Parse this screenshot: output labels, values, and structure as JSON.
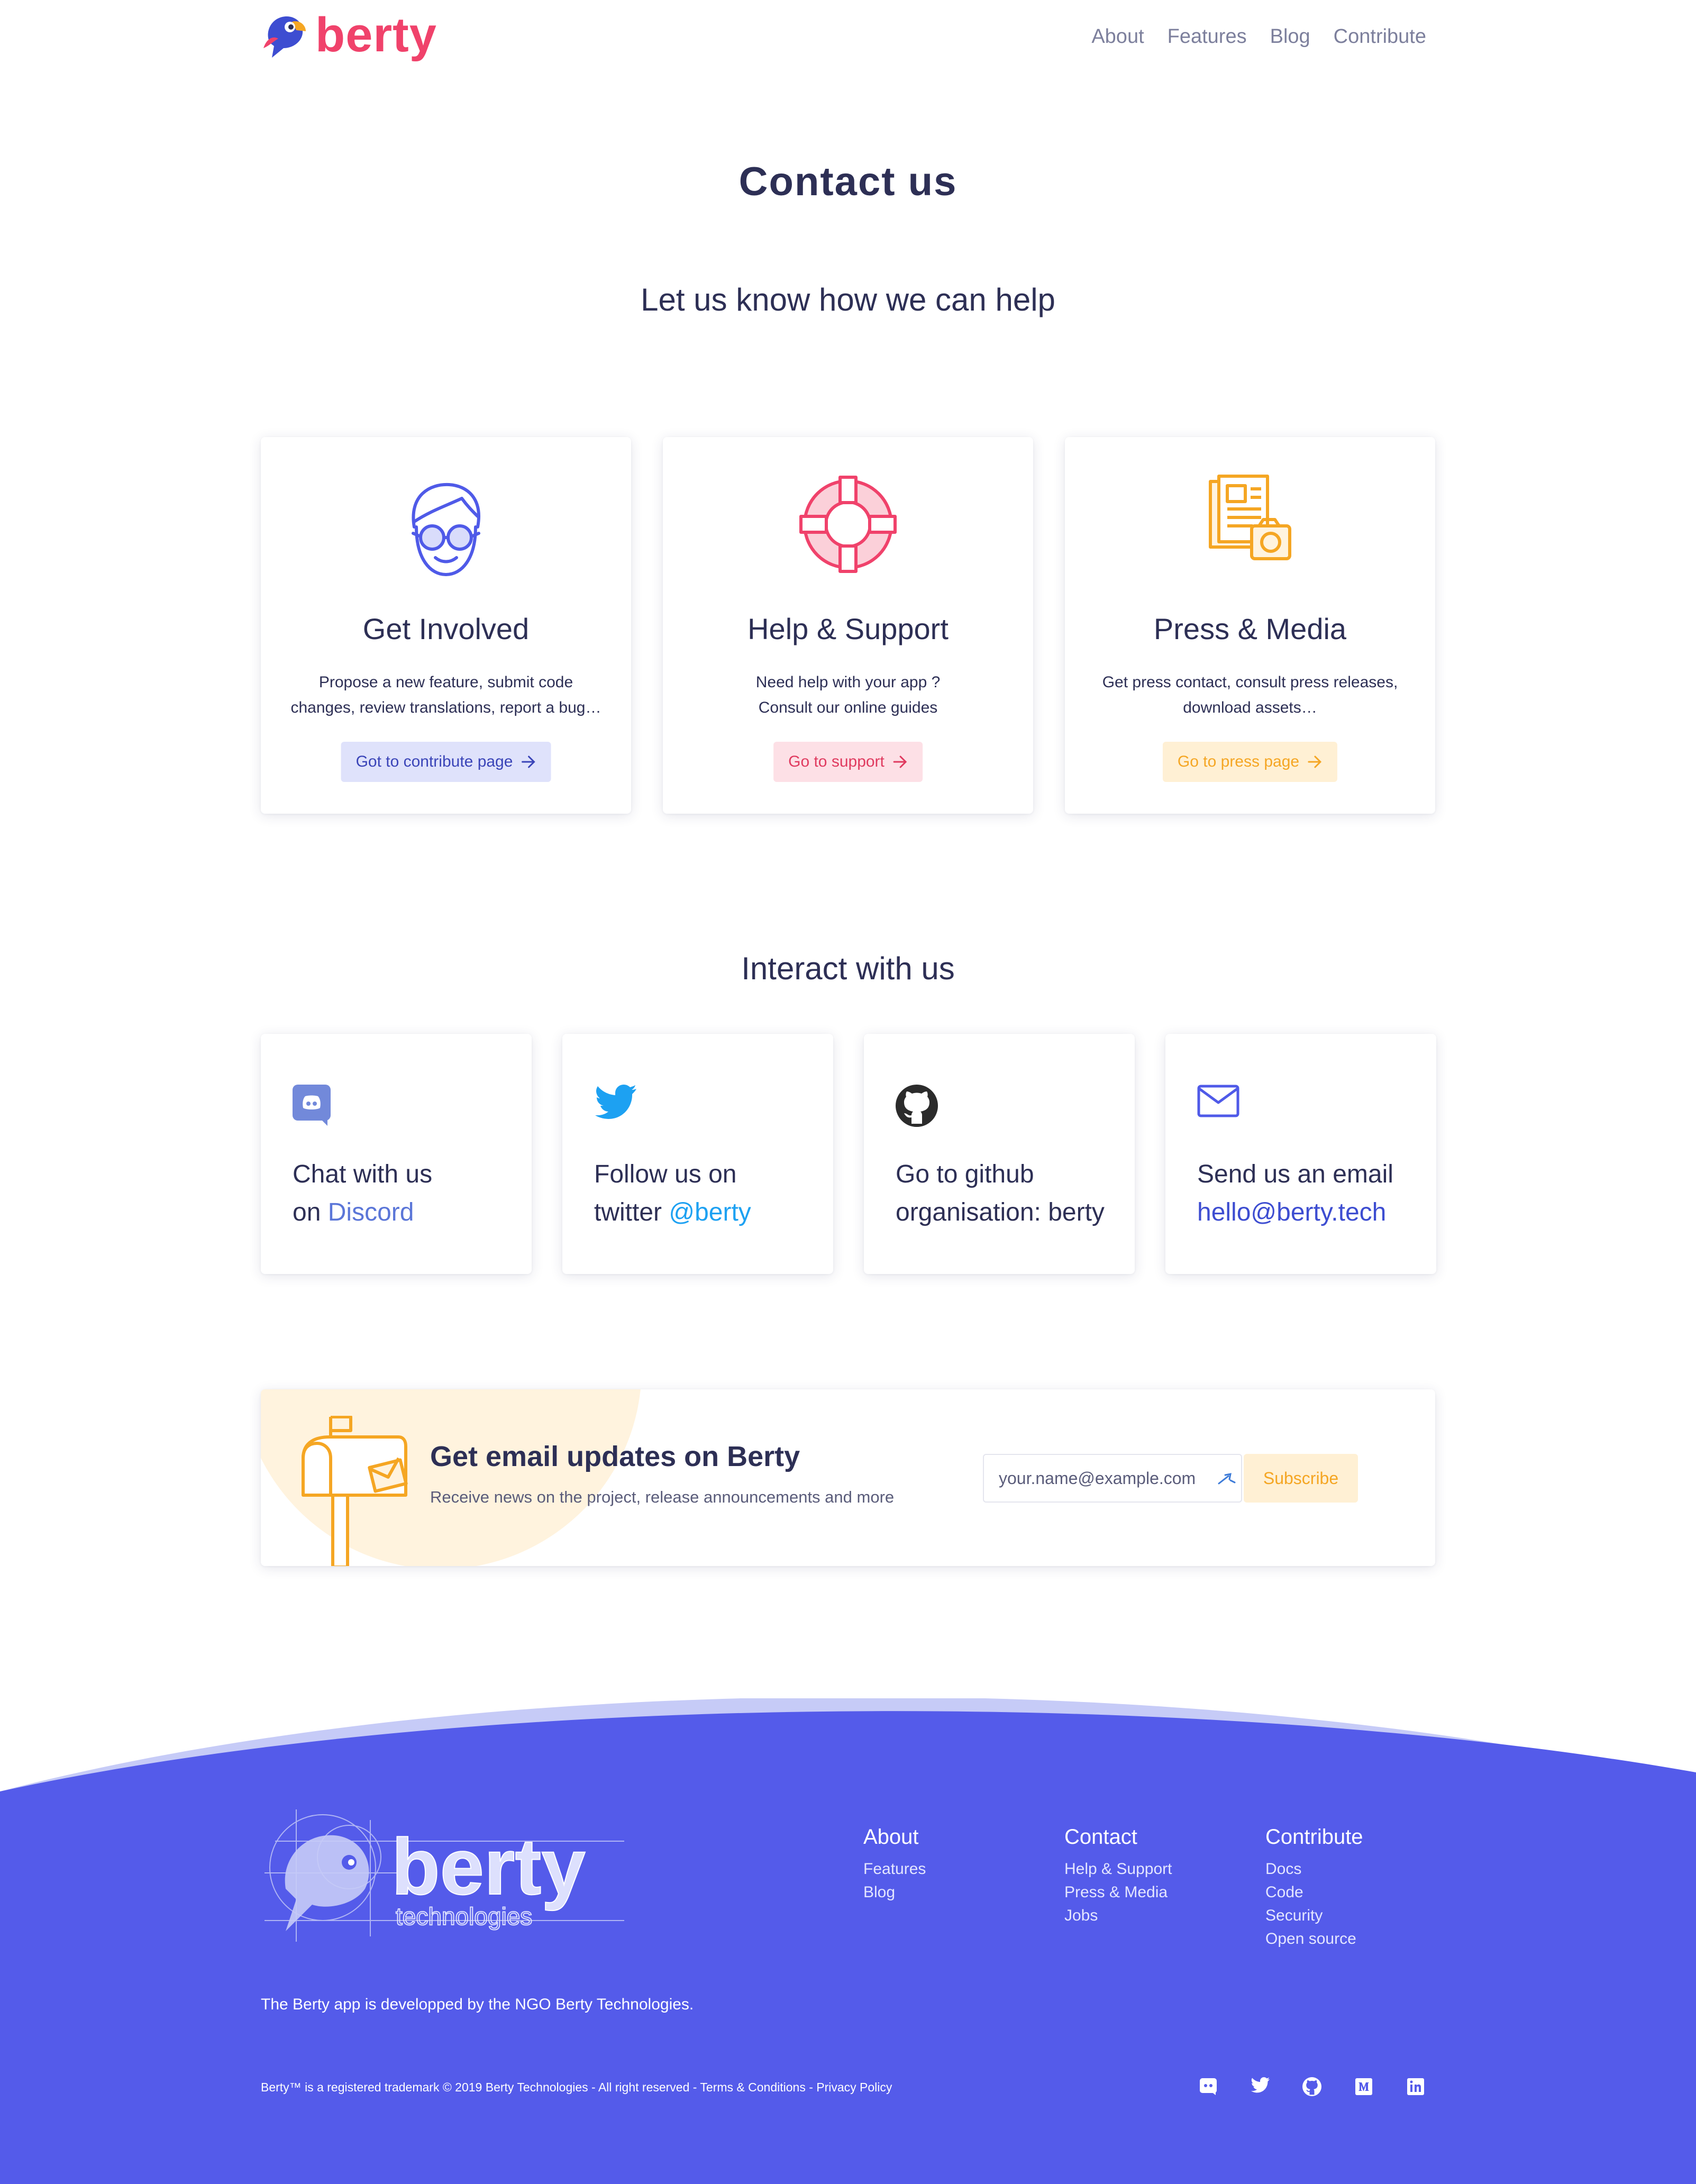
{
  "header": {
    "logo_text": "berty",
    "nav": [
      "About",
      "Features",
      "Blog",
      "Contribute"
    ]
  },
  "page": {
    "title": "Contact us",
    "subtitle": "Let us know how we can help"
  },
  "help_cards": [
    {
      "title": "Get Involved",
      "desc_line1": "Propose a new feature, submit code",
      "desc_line2": "changes, review translations, report a bug…",
      "button": "Got to contribute page",
      "icon": "person-glasses-icon"
    },
    {
      "title": "Help & Support",
      "desc_line1": "Need help with your app ?",
      "desc_line2": "Consult our online guides",
      "button": "Go to support",
      "icon": "lifebuoy-icon"
    },
    {
      "title": "Press & Media",
      "desc_line1": "Get press contact, consult press releases,",
      "desc_line2": "download assets…",
      "button": "Go to press page",
      "icon": "newspaper-camera-icon"
    }
  ],
  "interact": {
    "title": "Interact with us",
    "cards": [
      {
        "line1": "Chat with us",
        "line2_prefix": "on ",
        "link": "Discord",
        "icon": "discord-icon"
      },
      {
        "line1": "Follow us on",
        "line2_prefix": "twitter ",
        "link": "@berty",
        "icon": "twitter-icon"
      },
      {
        "line1": "Go to github",
        "line2_prefix": "organisation: berty",
        "link": "",
        "icon": "github-icon"
      },
      {
        "line1": "Send us an email",
        "line2_prefix": "",
        "link": "hello@berty.tech",
        "icon": "email-icon"
      }
    ]
  },
  "newsletter": {
    "title": "Get email updates on Berty",
    "desc": "Receive news on the project, release announcements and more",
    "placeholder": "your.name@example.com",
    "button": "Subscribe",
    "icon": "mailbox-icon"
  },
  "footer": {
    "logo_text": "berty",
    "logo_subtext": "technologies",
    "columns": [
      {
        "heading": "About",
        "items": [
          "Features",
          "Blog"
        ]
      },
      {
        "heading": "Contact",
        "items": [
          "Help & Support",
          "Press & Media",
          "Jobs"
        ]
      },
      {
        "heading": "Contribute",
        "items": [
          "Docs",
          "Code",
          "Security",
          "Open source"
        ]
      }
    ],
    "note": "The Berty app is developped by the NGO Berty Technologies.",
    "copyright": "Berty™ is a registered trademark © 2019 Berty Technologies - All right reserved - Terms & Conditions - Privacy Policy",
    "social_icons": [
      "discord-icon",
      "twitter-icon",
      "github-icon",
      "medium-icon",
      "linkedin-icon"
    ]
  },
  "colors": {
    "brand_pink": "#f0426b",
    "brand_blue": "#4f5ae8",
    "text_dark": "#2d2f55",
    "accent_orange": "#f5a623"
  }
}
